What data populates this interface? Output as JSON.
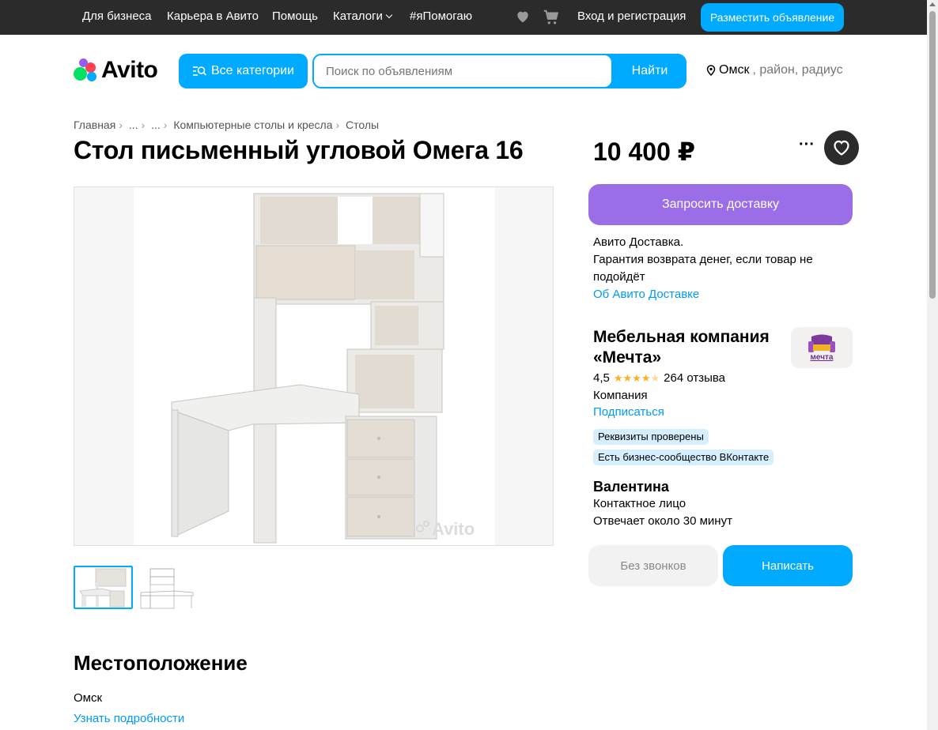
{
  "topbar": {
    "links": [
      "Для бизнеса",
      "Карьера в Авито",
      "Помощь",
      "Каталоги",
      "#яПомогаю"
    ],
    "login": "Вход и регистрация",
    "post_button": "Разместить объявление",
    "icons": [
      "heart-icon",
      "cart-icon"
    ]
  },
  "header": {
    "logo": "Avito",
    "categories_button": "Все категории",
    "search_placeholder": "Поиск по объявлениям",
    "search_button": "Найти",
    "location_city": "Омск",
    "location_rest": ", район, радиус"
  },
  "breadcrumb": [
    "Главная",
    "...",
    "...",
    "Компьютерные столы и кресла",
    "Столы"
  ],
  "listing": {
    "title": "Стол письменный угловой Омега 16",
    "price": "10 400 ₽",
    "watermark": "Avito"
  },
  "delivery": {
    "button": "Запросить доставку",
    "line1": "Авито Доставка.",
    "line2": "Гарантия возврата денег, если товар не подойдёт",
    "link": "Об Авито Доставке"
  },
  "seller": {
    "name": "Мебельная компания «Мечта»",
    "logo_text": "мечта",
    "rating": "4,5",
    "stars_shown": 4.5,
    "reviews": "264 отзыва",
    "type": "Компания",
    "subscribe": "Подписаться",
    "badges": [
      "Реквизиты проверены",
      "Есть бизнес-сообщество ВКонтакте"
    ]
  },
  "contact": {
    "name": "Валентина",
    "role": "Контактное лицо",
    "response": "Отвечает около 30 минут",
    "no_calls": "Без звонков",
    "write": "Написать"
  },
  "location_section": {
    "heading": "Местоположение",
    "city": "Омск",
    "details_link": "Узнать подробности"
  },
  "colors": {
    "accent": "#00aaff",
    "delivery": "#9b6ee8",
    "topbar": "#2b2b2b",
    "link": "#0099f7"
  }
}
